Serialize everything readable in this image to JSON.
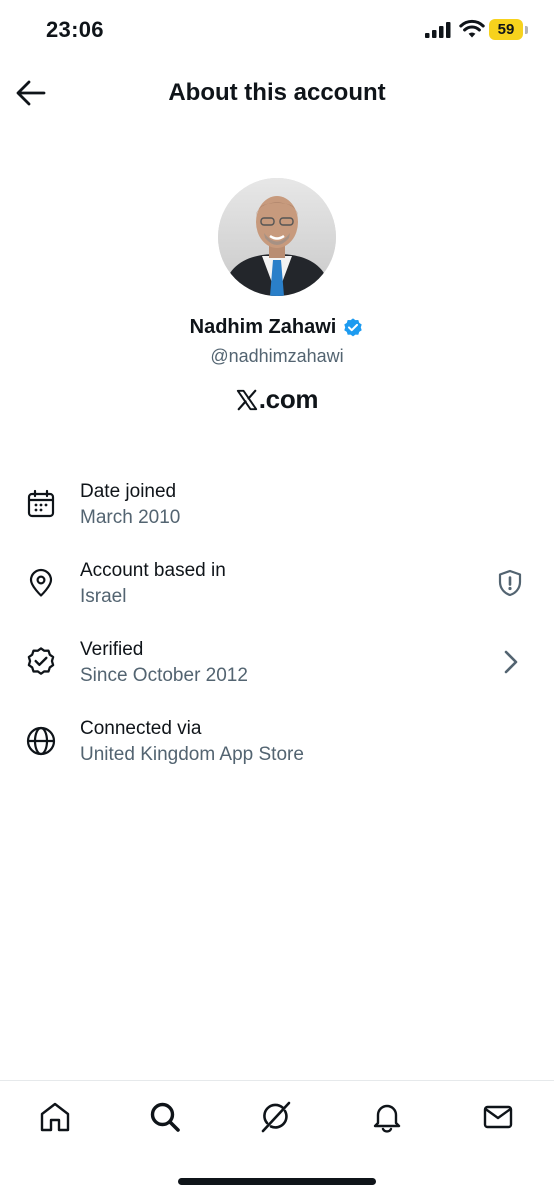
{
  "status_bar": {
    "time": "23:06",
    "battery_level": "59",
    "battery_color": "#f7d21d"
  },
  "header": {
    "title": "About this account",
    "back_icon": "arrow-left-icon"
  },
  "profile": {
    "name": "Nadhim Zahawi",
    "handle": "@nadhimzahawi",
    "verified_badge_color": "#1d9bf0",
    "domain": ".com",
    "domain_logo": "x-logo-icon"
  },
  "info": {
    "date_joined": {
      "label": "Date joined",
      "value": "March 2010",
      "icon": "calendar-icon"
    },
    "account_based_in": {
      "label": "Account based in",
      "value": "Israel",
      "icon": "location-pin-icon",
      "trailing_icon": "shield-alert-icon"
    },
    "verified": {
      "label": "Verified",
      "value": "Since October 2012",
      "icon": "verified-badge-icon",
      "trailing_icon": "chevron-right-icon"
    },
    "connected_via": {
      "label": "Connected via",
      "value": "United Kingdom App Store",
      "icon": "globe-icon"
    }
  },
  "tab_bar": {
    "tabs": [
      "home-icon",
      "search-icon",
      "grok-icon",
      "notifications-bell-icon",
      "messages-envelope-icon"
    ]
  },
  "colors": {
    "text_primary": "#0f1419",
    "text_secondary": "#536471"
  }
}
